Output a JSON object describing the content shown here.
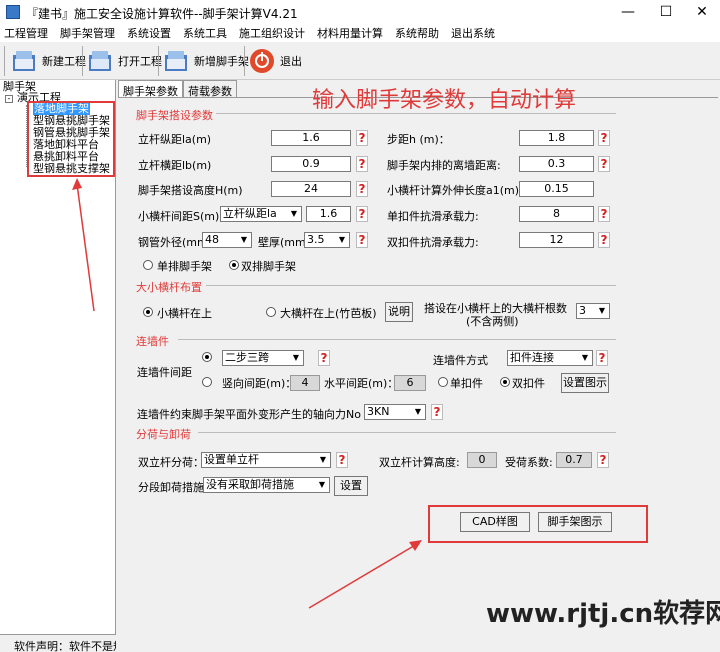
{
  "window": {
    "title": "『建书』施工安全设施计算软件--脚手架计算V4.21"
  },
  "menu": [
    "工程管理",
    "脚手架管理",
    "系统设置",
    "系统工具",
    "施工组织设计",
    "材料用量计算",
    "系统帮助",
    "退出系统"
  ],
  "toolbar": {
    "new_project": "新建工程",
    "open_project": "打开工程",
    "add_scaffold": "新增脚手架",
    "exit": "退出"
  },
  "tree": {
    "root": "脚手架",
    "project": "演示工程",
    "items": [
      "落地脚手架",
      "型钢悬挑脚手架",
      "钢管悬挑脚手架",
      "落地卸料平台",
      "悬挑卸料平台",
      "型钢悬挑支撑架"
    ]
  },
  "status": {
    "left": "软件声明：软件不是规"
  },
  "tabs": [
    "脚手架参数",
    "荷载参数"
  ],
  "annotation": "输入脚手架参数，自动计算",
  "section1": {
    "title": "脚手架搭设参数",
    "la_label": "立杆纵距la(m)",
    "la": "1.6",
    "h_label": "步距h (m)：",
    "h": "1.8",
    "lb_label": "立杆横距lb(m)",
    "lb": "0.9",
    "dist_label": "脚手架内排的离墙距离:",
    "dist": "0.3",
    "H_label": "脚手架搭设高度H(m)",
    "H": "24",
    "a1_label": "小横杆计算外伸长度a1(m):",
    "a1": "0.15",
    "s_label": "小横杆间距S(m)",
    "s_select": "立杆纵距la",
    "s": "1.6",
    "single_label": "单扣件抗滑承载力:",
    "single": "8",
    "pipe_label": "钢管外径(mm)",
    "pipe": "48",
    "wall_label": "壁厚(mm)",
    "wall": "3.5",
    "double_label": "双扣件抗滑承载力:",
    "double": "12",
    "radio_single": "单排脚手架",
    "radio_double": "双排脚手架"
  },
  "section2": {
    "title": "大小横杆布置",
    "small_top": "小横杆在上",
    "big_top": "大横杆在上(竹芭板)",
    "explain": "说明",
    "count_label1": "搭设在小横杆上的大横杆根数",
    "count_label2": "(不含两侧)",
    "count": "3"
  },
  "section3": {
    "title": "连墙件",
    "spacing_label": "连墙件间距",
    "pattern": "二步三跨",
    "vert_label": "竖向间距(m)：",
    "vert": "4",
    "horiz_label": "水平间距(m)：",
    "horiz": "6",
    "method_label": "连墙件方式",
    "method": "扣件连接",
    "single_fastener": "单扣件",
    "double_fastener": "双扣件",
    "show_button": "设置图示",
    "axial_label": "连墙件约束脚手架平面外变形产生的轴向力No",
    "axial": "3KN"
  },
  "section4": {
    "title": "分荷与卸荷",
    "split_label": "双立杆分荷：",
    "split": "设置单立杆",
    "height_label": "双立杆计算高度:",
    "height": "0",
    "coef_label": "受荷系数:",
    "coef": "0.7",
    "unload_label": "分段卸荷措施：",
    "unload": "没有采取卸荷措施",
    "set_button": "设置"
  },
  "buttons": {
    "cad": "CAD样图",
    "diagram": "脚手架图示"
  },
  "watermark": "www.rjtj.cn软荐网",
  "colors": {
    "accent": "#e03a3a",
    "selection": "#3399ff"
  }
}
